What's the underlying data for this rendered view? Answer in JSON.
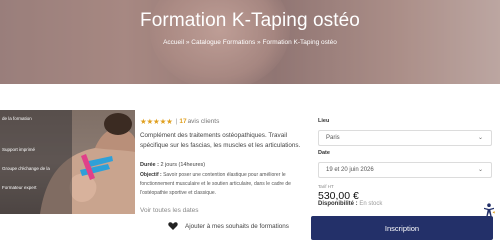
{
  "hero": {
    "title": "Formation K-Taping ostéo",
    "breadcrumb": [
      "Accueil",
      "Catalogue Formations",
      "Formation K-Taping ostéo"
    ],
    "separator": "»"
  },
  "photo_overlay": {
    "items": [
      "de la formation",
      "Support imprimé",
      "Groupe d'échange de la",
      "Formateur expert"
    ]
  },
  "rating": {
    "stars": "★★★★★",
    "count": "17",
    "clients_label": "avis clients",
    "star_color": "#e0a020"
  },
  "product": {
    "description": "Complément des traitements ostéopathiques. Travail spécifique sur les fascias, les muscles et les articulations.",
    "duree_label": "Durée :",
    "duree_value": "2 jours (14heures)",
    "objectif_label": "Objectif :",
    "objectif_value": "Savoir poser une contention élastique pour améliorer le fonctionnement musculaire et le soutien articulaire, dans le cadre de l'ostéopathie sportive et classique.",
    "dates_link": "Voir toutes les dates",
    "wishlist_label": "Ajouter à mes souhaits de formations"
  },
  "booking": {
    "lieu_label": "Lieu",
    "lieu_value": "Paris",
    "date_label": "Date",
    "date_value": "19 et 20 juin 2026",
    "tarif_label": "Tarif HT",
    "price": "530,00 €",
    "dispo_label": "Disponibilité :",
    "dispo_value": "En stock",
    "button_label": "Inscription",
    "button_color": "#233069"
  },
  "icons": {
    "heart": "heart-icon",
    "chevron": "chevron-down-icon",
    "accessibility": "accessibility-icon"
  }
}
